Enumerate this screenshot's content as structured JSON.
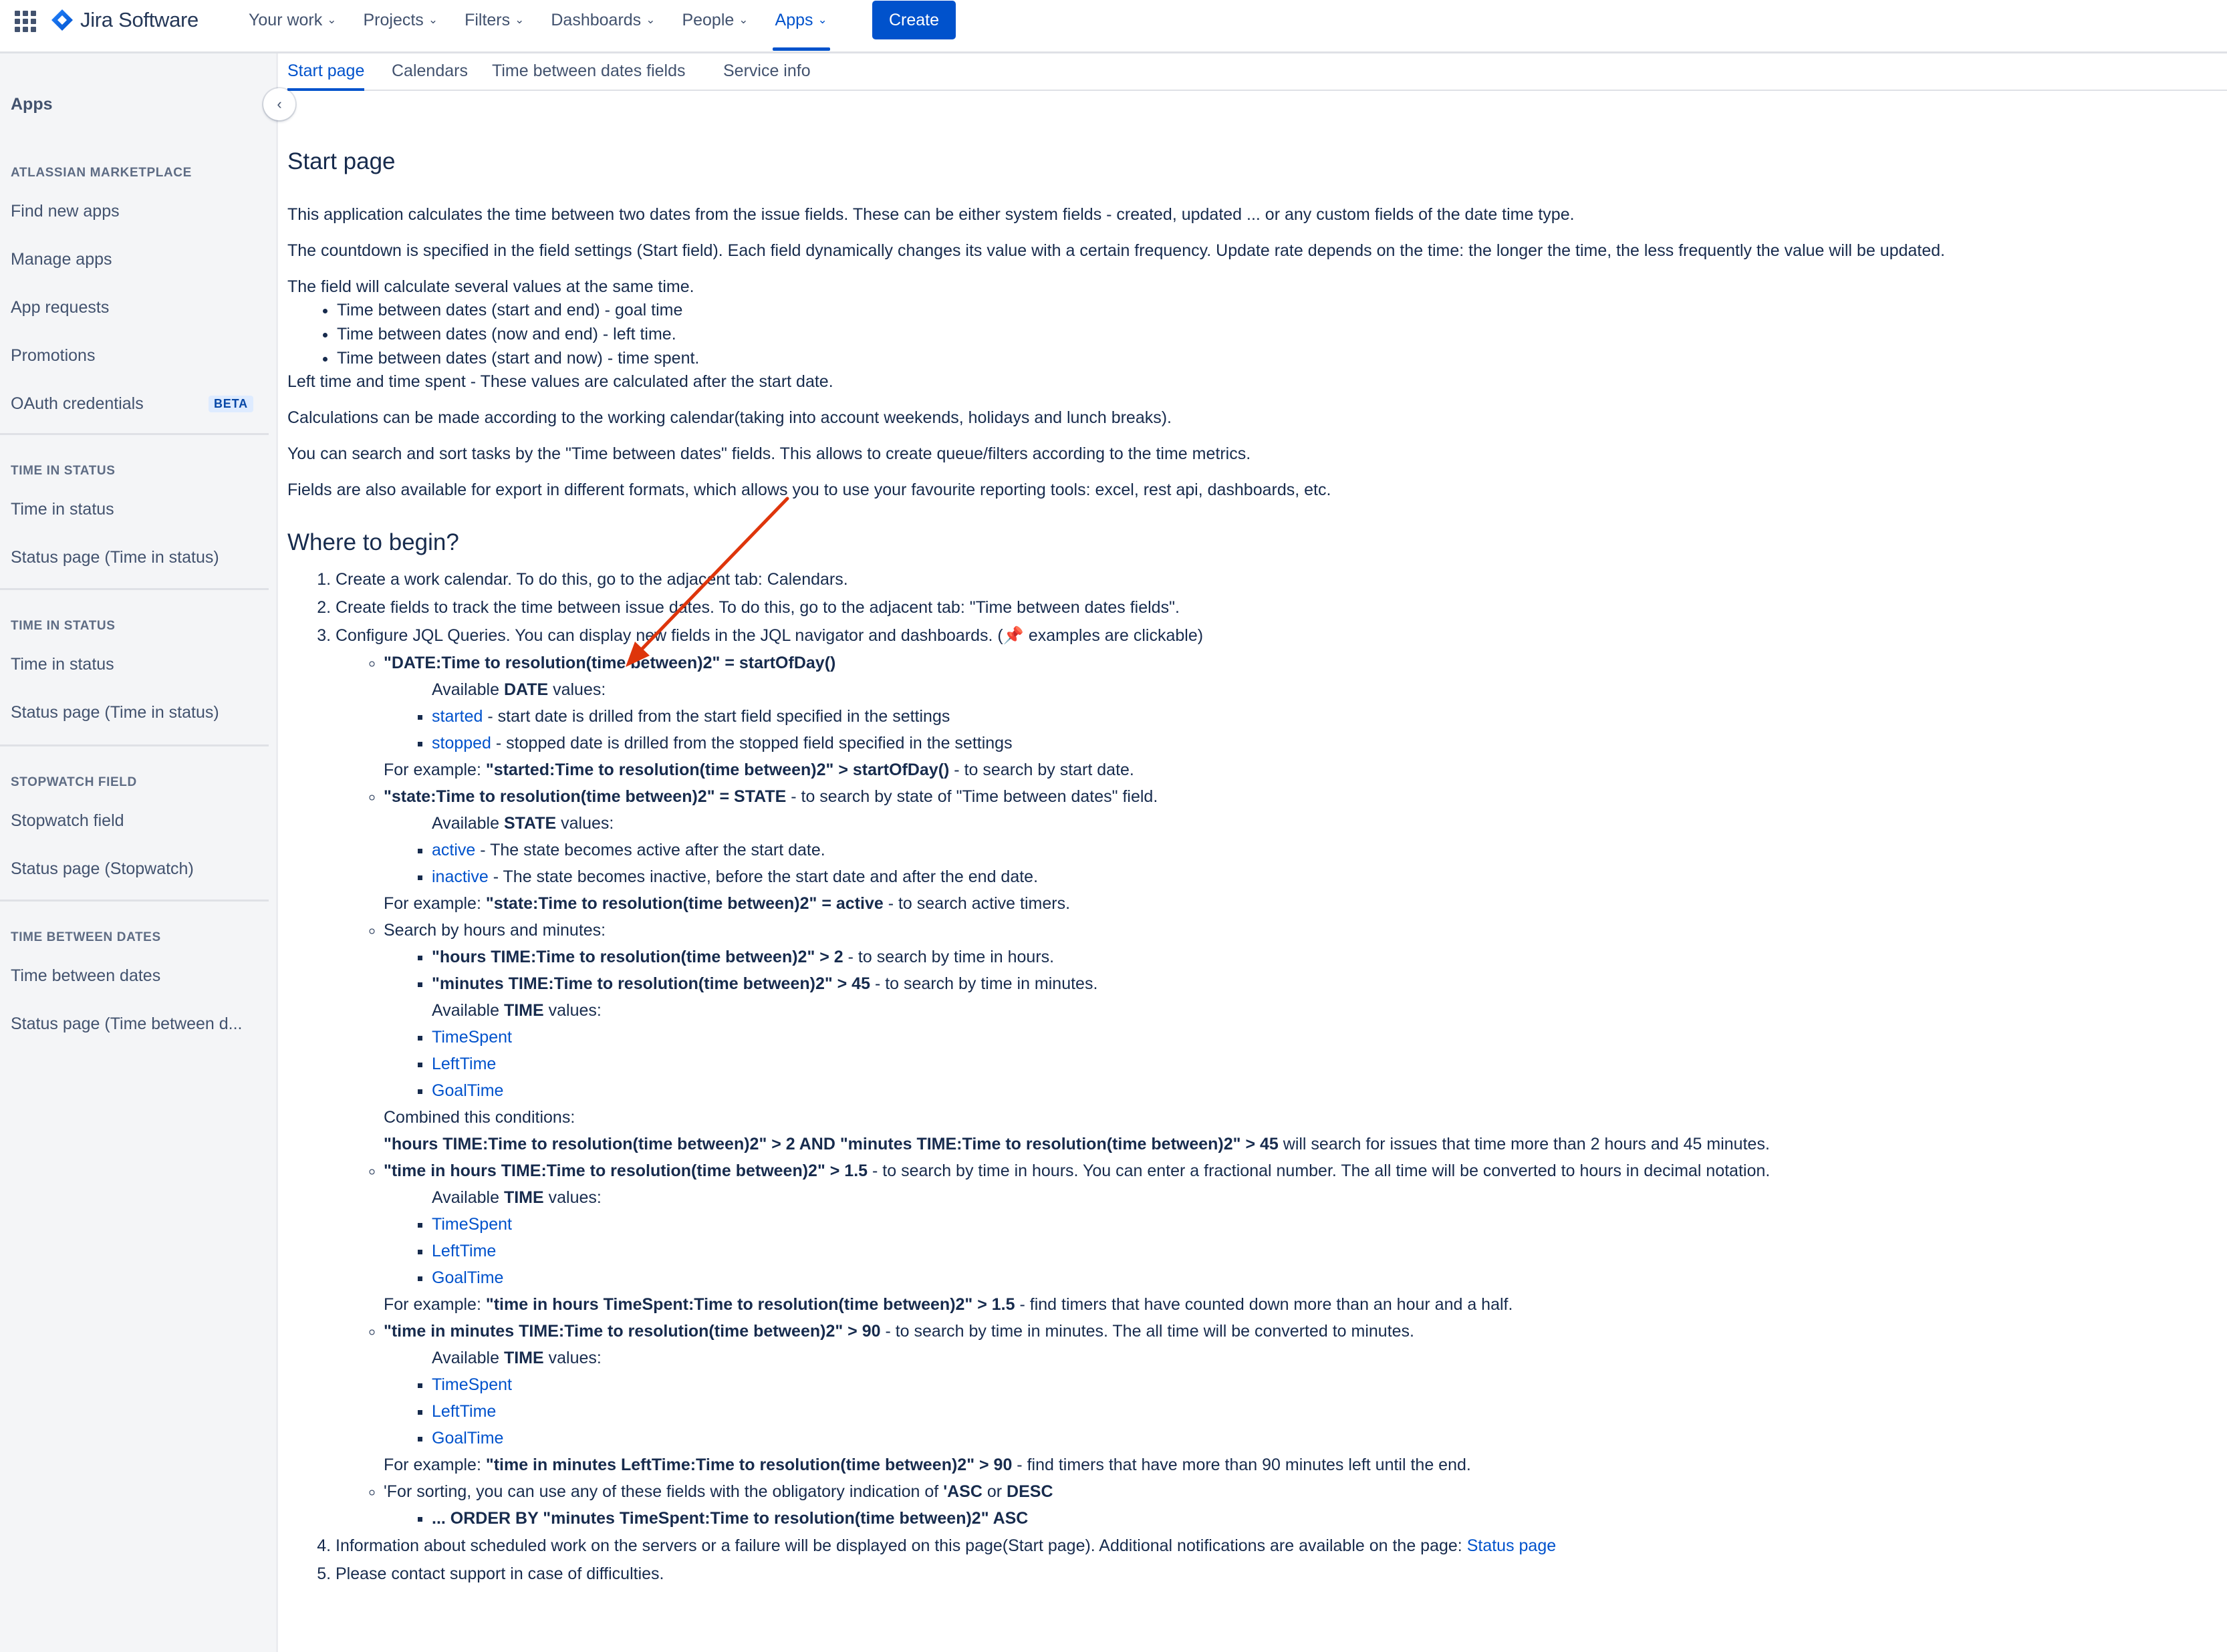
{
  "nav": {
    "product": "Jira Software",
    "menu": [
      {
        "label": "Your work"
      },
      {
        "label": "Projects"
      },
      {
        "label": "Filters"
      },
      {
        "label": "Dashboards"
      },
      {
        "label": "People"
      },
      {
        "label": "Apps"
      }
    ],
    "create_label": "Create"
  },
  "sidebar": {
    "title": "Apps",
    "sections": [
      {
        "title": "ATLASSIAN MARKETPLACE",
        "items": [
          "Find new apps",
          "Manage apps",
          "App requests",
          "Promotions",
          "OAuth credentials"
        ]
      },
      {
        "title": "TIME IN STATUS",
        "items": [
          "Time in status",
          "Status page (Time in status)"
        ]
      },
      {
        "title": "TIME IN STATUS",
        "items": [
          "Time in status",
          "Status page (Time in status)"
        ]
      },
      {
        "title": "STOPWATCH FIELD",
        "items": [
          "Stopwatch field",
          "Status page (Stopwatch)"
        ]
      },
      {
        "title": "TIME BETWEEN DATES",
        "items": [
          "Time between dates",
          "Status page (Time between d..."
        ]
      }
    ],
    "beta_badge": "BETA"
  },
  "tabs": [
    "Start page",
    "Calendars",
    "Time between dates fields",
    "Service info"
  ],
  "page": {
    "title": "Start page",
    "intro": [
      "This application calculates the time between two dates from the issue fields. These can be either system fields - created, updated ... or any custom fields of the date time type.",
      "The countdown is specified in the field settings (Start field). Each field dynamically changes its value with a certain frequency. Update rate depends on the time: the longer the time, the less frequently the value will be updated."
    ],
    "calc_intro": "The field will calculate several values at the same time.",
    "calc_items": [
      "Time between dates (start and end) - goal time",
      "Time between dates (now and end) - left time.",
      "Time between dates (start and now) - time spent."
    ],
    "after_calc": "Left time and time spent - These values are calculated after the start date.",
    "paras": [
      "Calculations can be made according to the working calendar(taking into account weekends, holidays and lunch breaks).",
      "You can search and sort tasks by the \"Time between dates\" fields. This allows to create queue/filters according to the time metrics.",
      "Fields are also available for export in different formats, which allows you to use your favourite reporting tools: excel, rest api, dashboards, etc."
    ],
    "where_title": "Where to begin?",
    "step1": "Create a work calendar. To do this, go to the adjacent tab: Calendars.",
    "step2": "Create fields to track the time between issue dates. To do this, go to the adjacent tab: \"Time between dates fields\".",
    "step3_a": "Configure JQL Queries. You can display new fields in the JQL navigator and dashboards. (",
    "step3_pin": "📌",
    "step3_b": " examples are clickable)",
    "q_date": "\"DATE:Time to resolution(time between)2\" = startOfDay()",
    "avail": "Available ",
    "values_word": " values:",
    "kw_date": "DATE",
    "kw_state": "STATE",
    "kw_time": "TIME",
    "date_vals": [
      {
        "link": "started",
        "text": " - start date is drilled from the start field specified in the settings"
      },
      {
        "link": "stopped",
        "text": " - stopped date is drilled from the stopped field specified in the settings"
      }
    ],
    "for_example": "For example: ",
    "ex_date_q": "\"started:Time to resolution(time between)2\" > startOfDay()",
    "ex_date_t": " - to search by start date.",
    "q_state": "\"state:Time to resolution(time between)2\" = STATE",
    "q_state_t": " - to search by state of \"Time between dates\" field.",
    "state_vals": [
      {
        "link": "active",
        "text": " - The state becomes active after the start date."
      },
      {
        "link": "inactive",
        "text": " - The state becomes inactive, before the start date and after the end date."
      }
    ],
    "ex_state_q": "\"state:Time to resolution(time between)2\" = active",
    "ex_state_t": " - to search active timers.",
    "hm_title": "Search by hours and minutes:",
    "hm_q1": "\"hours TIME:Time to resolution(time between)2\" > 2",
    "hm_t1": " - to search by time in hours.",
    "hm_q2": "\"minutes TIME:Time to resolution(time between)2\" > 45",
    "hm_t2": " - to search by time in minutes.",
    "time_vals": [
      "TimeSpent",
      "LeftTime",
      "GoalTime"
    ],
    "combined": "Combined this conditions:",
    "combined_q": "\"hours TIME:Time to resolution(time between)2\" > 2 AND \"minutes TIME:Time to resolution(time between)2\" > 45",
    "combined_t": " will search for issues that time more than 2 hours and 45 minutes.",
    "th_q": "\"time in hours TIME:Time to resolution(time between)2\" > 1.5",
    "th_t": " - to search by time in hours. You can enter a fractional number. The all time will be converted to hours in decimal notation.",
    "th_ex_q": "\"time in hours TimeSpent:Time to resolution(time between)2\" > 1.5",
    "th_ex_t": " - find timers that have counted down more than an hour and a half.",
    "tm_q": "\"time in minutes TIME:Time to resolution(time between)2\" > 90",
    "tm_t": " - to search by time in minutes. The all time will be converted to minutes.",
    "tm_ex_q": "\"time in minutes LeftTime:Time to resolution(time between)2\" > 90",
    "tm_ex_t": " - find timers that have more than 90 minutes left until the end.",
    "sort_a": "'For sorting, you can use any of these fields with the obligatory indication of ",
    "sort_asc": "'ASC",
    "sort_or": " or ",
    "sort_desc": "DESC",
    "sort_q": "... ORDER BY \"minutes TimeSpent:Time to resolution(time between)2\" ASC",
    "step4": "Information about scheduled work on the servers or a failure will be displayed on this page(Start page). Additional notifications are available on the page: ",
    "step4_link": "Status page",
    "step5": "Please contact support in case of difficulties."
  },
  "colors": {
    "accent": "#0052cc",
    "annotation_arrow": "#de350b"
  }
}
